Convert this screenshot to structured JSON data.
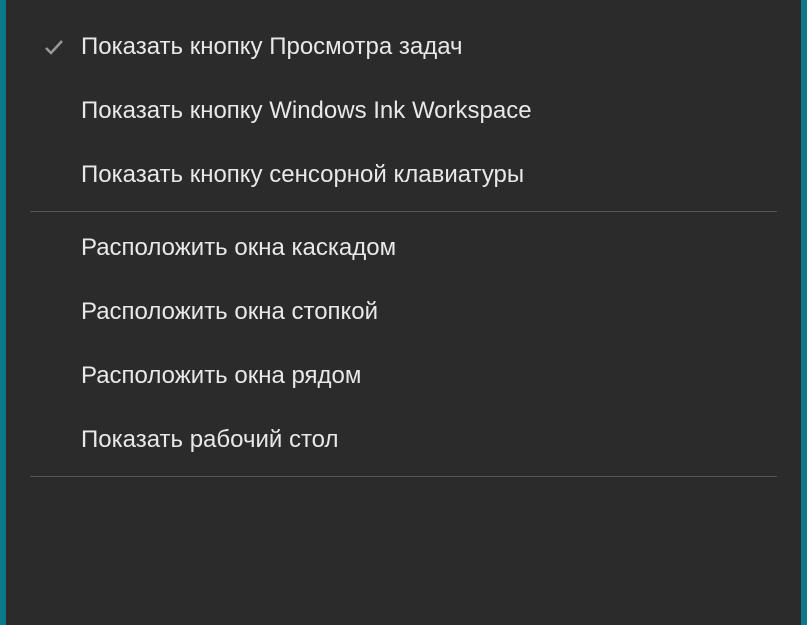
{
  "contextMenu": {
    "items": [
      {
        "label": "Показать кнопку Просмотра задач",
        "checked": true
      },
      {
        "label": "Показать кнопку Windows Ink Workspace",
        "checked": false
      },
      {
        "label": "Показать кнопку сенсорной клавиатуры",
        "checked": false
      },
      {
        "separator": true
      },
      {
        "label": "Расположить окна каскадом",
        "checked": false
      },
      {
        "label": "Расположить окна стопкой",
        "checked": false
      },
      {
        "label": "Расположить окна рядом",
        "checked": false
      },
      {
        "label": "Показать рабочий стол",
        "checked": false
      },
      {
        "separator": true
      }
    ]
  }
}
